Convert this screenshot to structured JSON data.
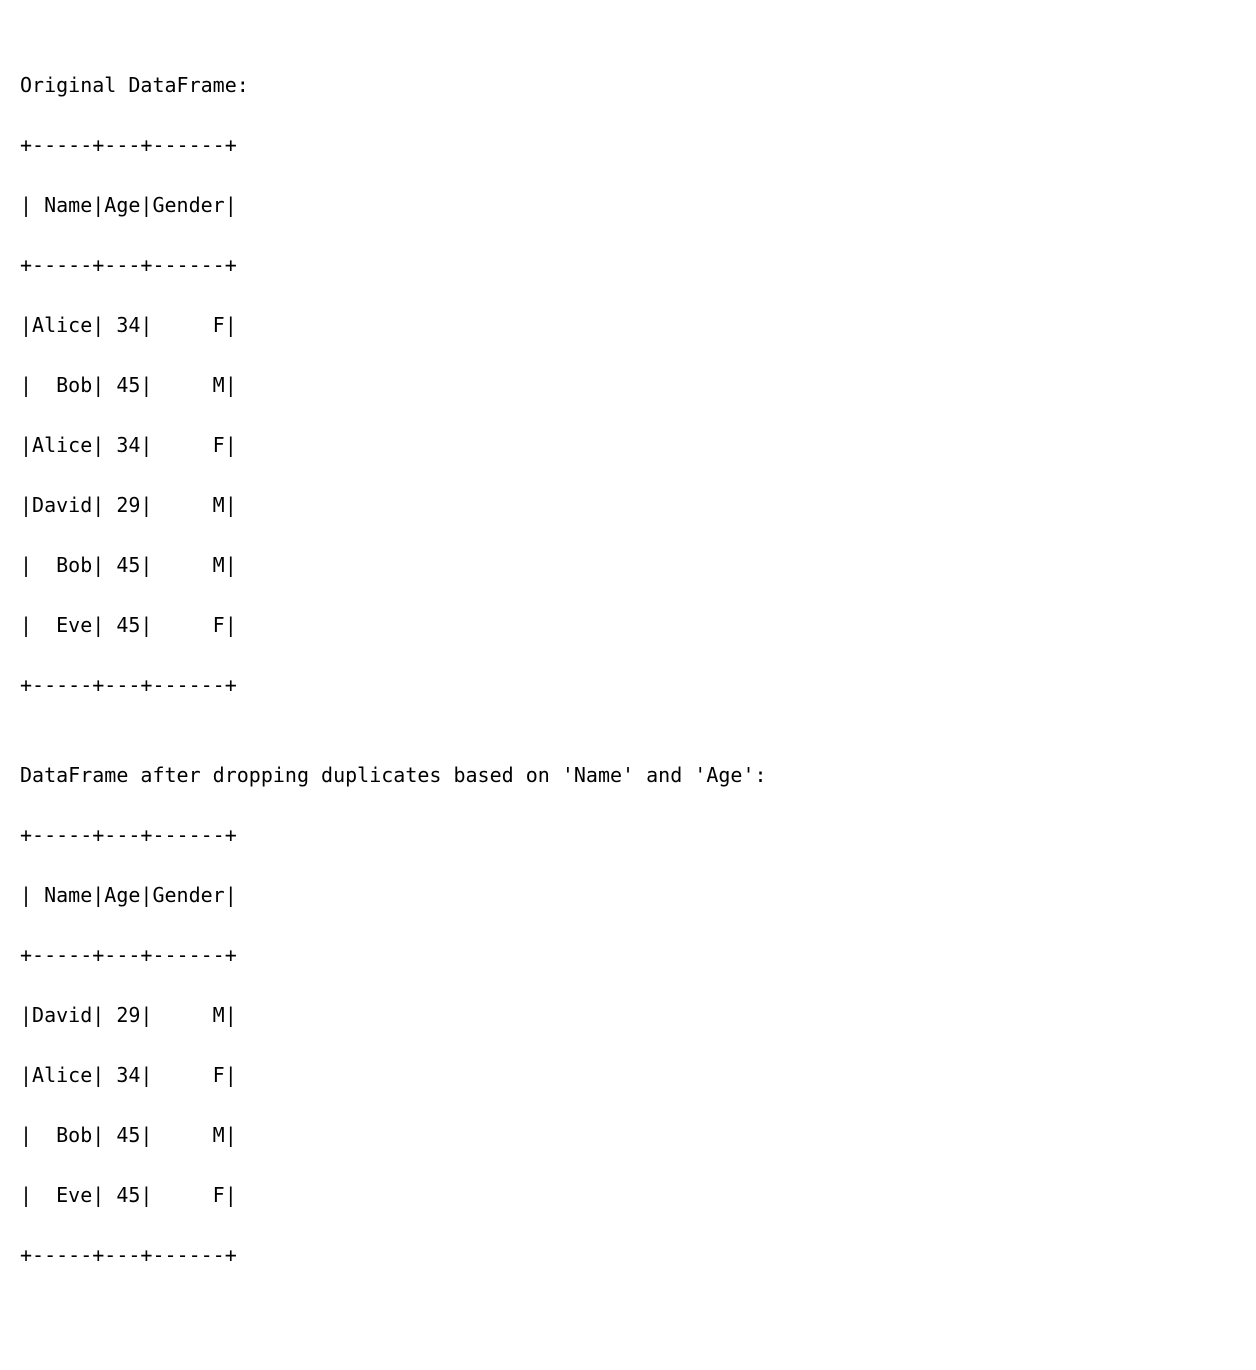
{
  "section1": {
    "title": "Original DataFrame:",
    "border": "+-----+---+------+",
    "header": "| Name|Age|Gender|",
    "rows": [
      "|Alice| 34|     F|",
      "|  Bob| 45|     M|",
      "|Alice| 34|     F|",
      "|David| 29|     M|",
      "|  Bob| 45|     M|",
      "|  Eve| 45|     F|"
    ]
  },
  "section2": {
    "title": "DataFrame after dropping duplicates based on 'Name' and 'Age':",
    "border": "+-----+---+------+",
    "header": "| Name|Age|Gender|",
    "rows": [
      "|David| 29|     M|",
      "|Alice| 34|     F|",
      "|  Bob| 45|     M|",
      "|  Eve| 45|     F|"
    ]
  },
  "blank": ""
}
